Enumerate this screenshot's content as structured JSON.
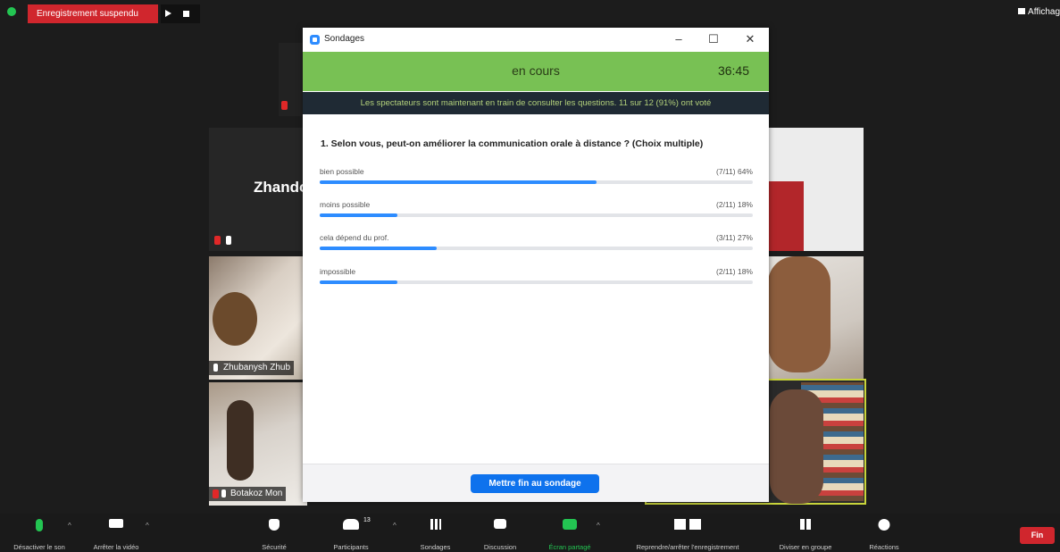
{
  "top_bar": {
    "recording_status": "Enregistrement suspendu",
    "view_label": "Affichag"
  },
  "tiles": {
    "big_name": "Zhando",
    "name_b": "Zhubanysh Zhub",
    "name_c": "Botakoz Mon"
  },
  "poll_window": {
    "title": "Sondages",
    "status": "en cours",
    "timer": "36:45",
    "info": "Les spectateurs sont maintenant en train de consulter les questions. 11 sur 12 (91%) ont voté",
    "question": "1. Selon vous, peut-on améliorer la communication orale à distance ? (Choix multiple)",
    "options": [
      {
        "label": "bien possible",
        "stat": "(7/11) 64%",
        "percent": 64
      },
      {
        "label": "moins possible",
        "stat": "(2/11) 18%",
        "percent": 18
      },
      {
        "label": "cela dépend du prof.",
        "stat": "(3/11) 27%",
        "percent": 27
      },
      {
        "label": "impossible",
        "stat": "(2/11) 18%",
        "percent": 18
      }
    ],
    "end_button": "Mettre fin au sondage"
  },
  "toolbar": {
    "mute": "Désactiver le son",
    "video": "Arrêter la vidéo",
    "security": "Sécurité",
    "participants": "Participants",
    "participants_count": "13",
    "polls": "Sondages",
    "chat": "Discussion",
    "share": "Écran partagé",
    "record": "Reprendre/arrêter l'enregistrement",
    "breakout": "Diviser en groupe",
    "reactions": "Réactions",
    "end": "Fin"
  },
  "colors": {
    "status_green": "#78c154",
    "accent_blue": "#2d8cff",
    "record_red": "#d0262d",
    "share_green": "#23c552"
  }
}
